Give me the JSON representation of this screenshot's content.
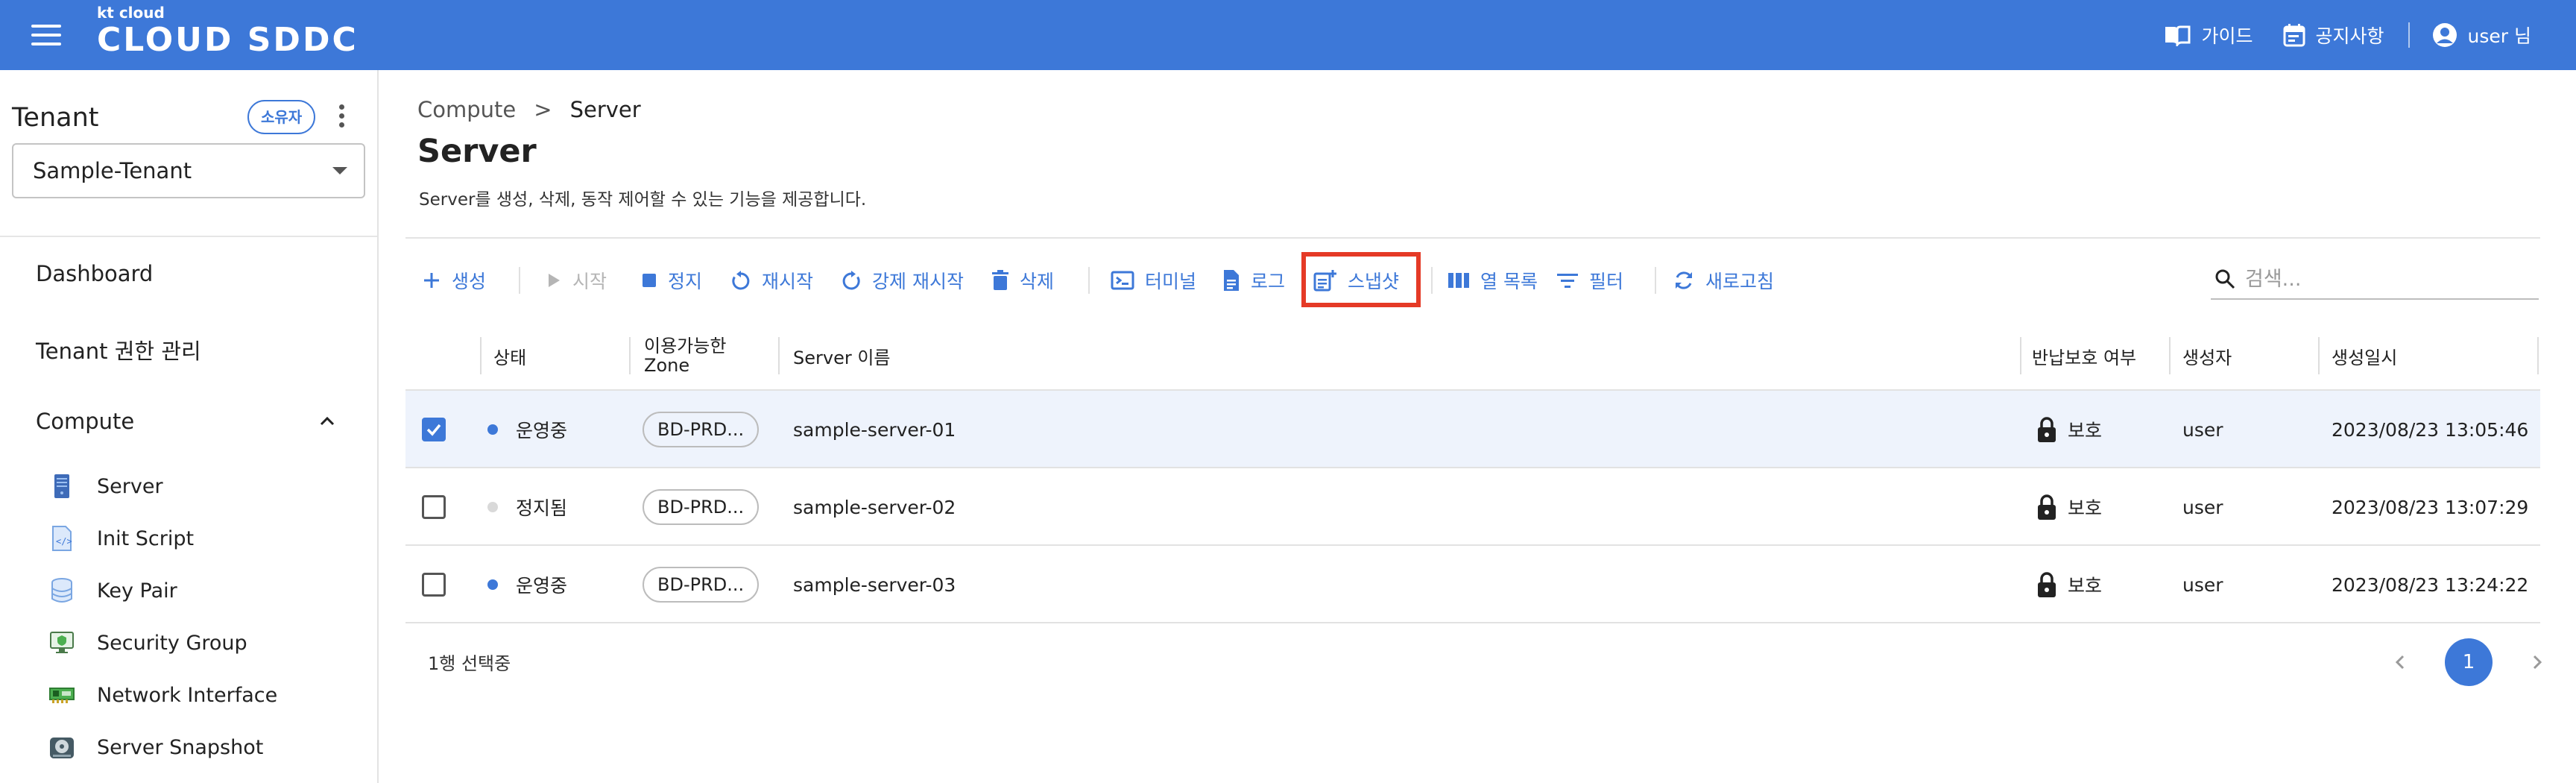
{
  "header": {
    "logo_small": "kt cloud",
    "logo_brand": "CLOUD SDDC",
    "guide_label": "가이드",
    "notice_label": "공지사항",
    "user_label": "user 님",
    "colors": {
      "bar": "#3d78d8"
    }
  },
  "sidebar": {
    "tenant_title": "Tenant",
    "owner_badge": "소유자",
    "tenant_selected": "Sample-Tenant",
    "nav": [
      {
        "label": "Dashboard"
      },
      {
        "label": "Tenant 권한 관리"
      },
      {
        "label": "Compute"
      }
    ],
    "compute_items": [
      {
        "label": "Server",
        "icon": "server-icon"
      },
      {
        "label": "Init Script",
        "icon": "script-file-icon"
      },
      {
        "label": "Key Pair",
        "icon": "database-icon"
      },
      {
        "label": "Security Group",
        "icon": "monitor-shield-icon"
      },
      {
        "label": "Network Interface",
        "icon": "network-card-icon"
      },
      {
        "label": "Server Snapshot",
        "icon": "disk-snapshot-icon"
      }
    ]
  },
  "main": {
    "breadcrumb": {
      "parent": "Compute",
      "separator": ">",
      "current": "Server"
    },
    "title": "Server",
    "description": "Server를 생성, 삭제, 동작 제어할 수 있는 기능을 제공합니다.",
    "toolbar": {
      "create": "생성",
      "start": "시작",
      "stop": "정지",
      "restart": "재시작",
      "force_restart": "강제 재시작",
      "delete": "삭제",
      "terminal": "터미널",
      "log": "로그",
      "snapshot": "스냅샷",
      "columns": "열 목록",
      "filter": "필터",
      "refresh": "새로고침"
    },
    "search": {
      "placeholder": "검색..."
    },
    "table": {
      "headers": {
        "status": "상태",
        "zone_line1": "이용가능한",
        "zone_line2": "Zone",
        "name": "Server 이름",
        "protect": "반납보호 여부",
        "creator": "생성자",
        "created": "생성일시"
      },
      "rows": [
        {
          "checked": true,
          "status": "운영중",
          "status_color": "#3d78d8",
          "zone": "BD-PRD...",
          "name": "sample-server-01",
          "protect": "보호",
          "creator": "user",
          "created": "2023/08/23 13:05:46"
        },
        {
          "checked": false,
          "status": "정지됨",
          "status_color": "#d9d9d9",
          "zone": "BD-PRD...",
          "name": "sample-server-02",
          "protect": "보호",
          "creator": "user",
          "created": "2023/08/23 13:07:29"
        },
        {
          "checked": false,
          "status": "운영중",
          "status_color": "#3d78d8",
          "zone": "BD-PRD...",
          "name": "sample-server-03",
          "protect": "보호",
          "creator": "user",
          "created": "2023/08/23 13:24:22"
        }
      ]
    },
    "footer": {
      "selected_text": "1행 선택중",
      "current_page": "1"
    }
  }
}
